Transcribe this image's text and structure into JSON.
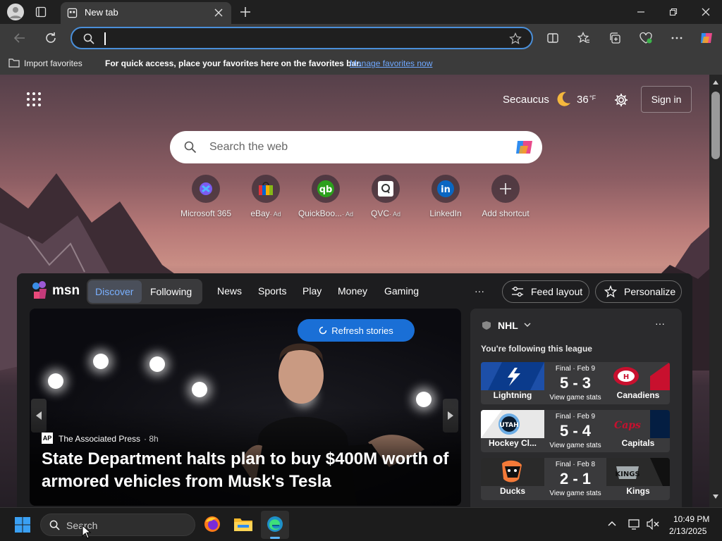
{
  "browser": {
    "tab_title": "New tab",
    "address_value": "",
    "favbar": {
      "import_label": "Import favorites",
      "message": "For quick access, place your favorites here on the favorites bar.",
      "manage_link": "Manage favorites now"
    }
  },
  "newtab": {
    "location": "Secaucus",
    "temperature": "36",
    "temp_unit": "°F",
    "sign_in": "Sign in",
    "search_placeholder": "Search the web",
    "shortcuts": [
      {
        "label": "Microsoft 365",
        "ad": ""
      },
      {
        "label": "eBay",
        "ad": "· Ad"
      },
      {
        "label": "QuickBoo...",
        "ad": "· Ad"
      },
      {
        "label": "QVC",
        "ad": "· Ad"
      },
      {
        "label": "LinkedIn",
        "ad": ""
      },
      {
        "label": "Add shortcut",
        "ad": ""
      }
    ]
  },
  "feed": {
    "brand": "msn",
    "tabs": [
      "Discover",
      "Following"
    ],
    "nav": [
      "News",
      "Sports",
      "Play",
      "Money",
      "Gaming"
    ],
    "more": "···",
    "feed_layout": "Feed layout",
    "personalize": "Personalize",
    "refresh": "Refresh stories",
    "story": {
      "source": "The Associated Press",
      "age": "· 8h",
      "headline": "State Department halts plan to buy $400M worth of armored vehicles from Musk's Tesla"
    },
    "league": {
      "name": "NHL",
      "following": "You're following this league",
      "games": [
        {
          "status": "Final · Feb 9",
          "home": "Lightning",
          "away": "Canadiens",
          "score": "5 - 3",
          "stats": "View game stats",
          "home_color": "#0b3b8c",
          "away_color": "#c8102e"
        },
        {
          "status": "Final · Feb 9",
          "home": "Hockey Cl...",
          "away": "Capitals",
          "score": "5 - 4",
          "stats": "View game stats",
          "home_color": "#6cace4",
          "away_color": "#041e42"
        },
        {
          "status": "Final · Feb 8",
          "home": "Ducks",
          "away": "Kings",
          "score": "2 - 1",
          "stats": "View game stats",
          "home_color": "#111111",
          "away_color": "#222222"
        }
      ]
    }
  },
  "taskbar": {
    "search_placeholder": "Search",
    "time": "10:49 PM",
    "date": "2/13/2025"
  }
}
